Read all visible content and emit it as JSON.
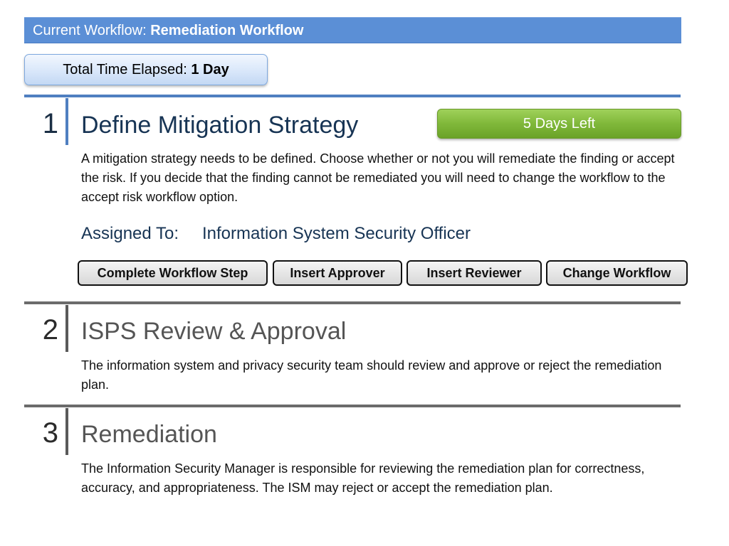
{
  "header": {
    "prefix": "Current Workflow:",
    "workflow_name": "Remediation Workflow"
  },
  "elapsed": {
    "label": "Total Time Elapsed:",
    "value": "1 Day"
  },
  "steps": [
    {
      "number": "1",
      "title": "Define Mitigation Strategy",
      "status": "5 Days Left",
      "description": "A mitigation strategy needs to be defined. Choose whether or not you will remediate the finding or accept the risk. If you decide that the finding cannot be remediated you will need to change the workflow to the accept risk workflow option.",
      "assigned_label": "Assigned To:",
      "assigned_value": "Information System Security Officer",
      "actions": [
        "Complete Workflow Step",
        "Insert Approver",
        "Insert Reviewer",
        "Change Workflow"
      ]
    },
    {
      "number": "2",
      "title": "ISPS Review & Approval",
      "description": "The information system and privacy security team should review and approve or reject the remediation plan."
    },
    {
      "number": "3",
      "title": "Remediation",
      "description": "The Information Security Manager is responsible for reviewing the remediation plan for correctness, accuracy, and appropriateness. The ISM may reject or accept the remediation plan."
    }
  ],
  "colors": {
    "header_bar": "#5b8fd6",
    "active_accent": "#4f7fc0",
    "status_green": "#80b83a",
    "inactive_rule": "#6b6b6b"
  }
}
